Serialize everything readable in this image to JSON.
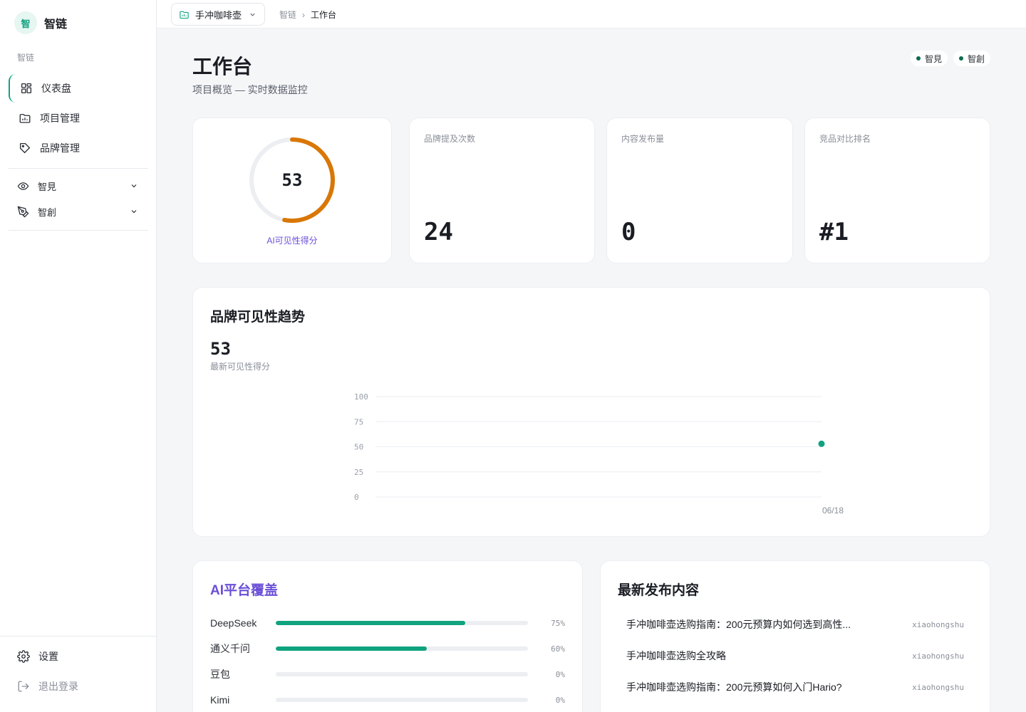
{
  "sidebar": {
    "brand_logo": "智",
    "brand_name": "智链",
    "section_label": "智链",
    "items": [
      {
        "label": "仪表盘",
        "icon": "dashboard-icon",
        "active": true
      },
      {
        "label": "项目管理",
        "icon": "folder-chart-icon"
      },
      {
        "label": "品牌管理",
        "icon": "tag-icon"
      }
    ],
    "groups": [
      {
        "label": "智見",
        "icon": "eye-icon"
      },
      {
        "label": "智創",
        "icon": "pen-tool-icon"
      }
    ],
    "footer": {
      "settings": "设置",
      "logout": "退出登录"
    }
  },
  "topbar": {
    "project": "手冲咖啡壶",
    "breadcrumb": [
      "智链",
      "工作台"
    ]
  },
  "header": {
    "title": "工作台",
    "subtitle": "项目概览 — 实时数据监控",
    "chips": [
      "智見",
      "智創"
    ]
  },
  "stats": {
    "score": 53,
    "score_label": "AI可见性得分",
    "mentions_label": "品牌提及次数",
    "mentions_value": "24",
    "published_label": "内容发布量",
    "published_value": "0",
    "rank_label": "竞品对比排名",
    "rank_value": "#1"
  },
  "trend": {
    "title": "品牌可见性趋势",
    "score": "53",
    "caption": "最新可见性得分"
  },
  "chart_data": {
    "type": "scatter",
    "x": [
      "06/18"
    ],
    "series": [
      {
        "values": [
          53
        ]
      }
    ],
    "yticks": [
      100,
      75,
      50,
      25,
      0
    ],
    "ylim": [
      0,
      100
    ],
    "grid": true,
    "color": "#10a37f"
  },
  "platforms": {
    "title": "AI平台覆盖",
    "rows": [
      {
        "name": "DeepSeek",
        "pct": 75,
        "pct_label": "75%"
      },
      {
        "name": "通义千问",
        "pct": 60,
        "pct_label": "60%"
      },
      {
        "name": "豆包",
        "pct": 0,
        "pct_label": "0%"
      },
      {
        "name": "Kimi",
        "pct": 0,
        "pct_label": "0%"
      }
    ]
  },
  "publish": {
    "title": "最新发布内容",
    "rows": [
      {
        "title": "手冲咖啡壶选购指南：200元预算内如何选到高性...",
        "source": "xiaohongshu"
      },
      {
        "title": "手冲咖啡壶选购全攻略",
        "source": "xiaohongshu"
      },
      {
        "title": "手冲咖啡壶选购指南：200元预算如何入门Hario?",
        "source": "xiaohongshu"
      }
    ]
  },
  "colors": {
    "accent": "#10a37f",
    "ring": "#d97706",
    "purple": "#6b4fd8"
  }
}
